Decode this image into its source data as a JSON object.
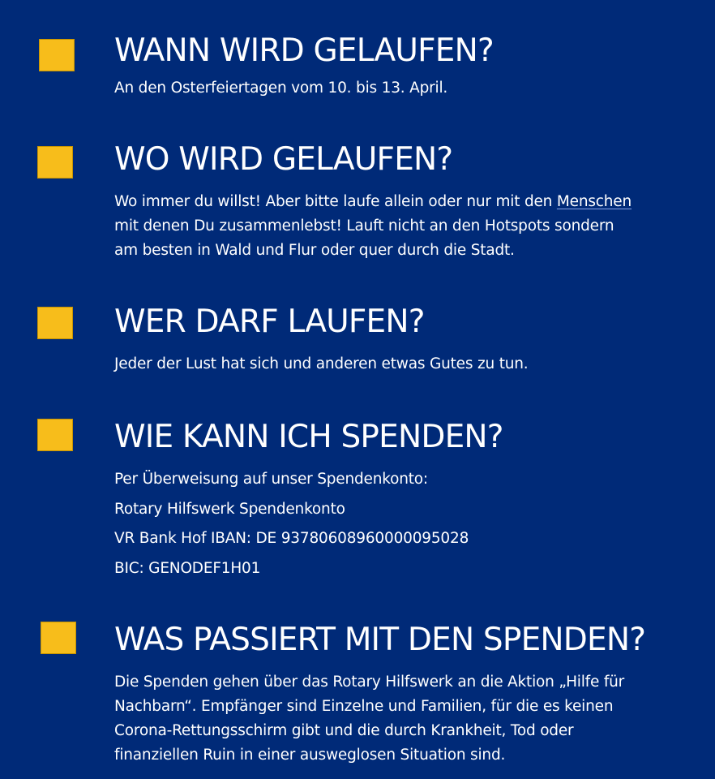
{
  "sections": [
    {
      "heading": "WANN WIRD GELAUFEN?",
      "lines": [
        "An den Osterfeiertagen vom 10. bis 13. April."
      ]
    },
    {
      "heading": "WO WIRD GELAUFEN?",
      "lines": [
        "Wo immer du willst!  Aber bitte laufe allein oder nur mit den ",
        "mit denen Du zusammenlebst!  Lauft nicht an den Hotspots sondern",
        "am besten in Wald und Flur oder quer durch die Stadt."
      ],
      "underlined_word": "Menschen"
    },
    {
      "heading": "WER DARF LAUFEN?",
      "lines": [
        "Jeder der Lust hat sich und anderen etwas Gutes zu tun."
      ]
    },
    {
      "heading": "WIE KANN ICH SPENDEN?",
      "lines": [
        "Per Überweisung auf unser Spendenkonto:",
        "Rotary Hilfswerk Spendenkonto",
        "VR Bank Hof IBAN: DE 93780608960000095028",
        "BIC: GENODEF1H01"
      ]
    },
    {
      "heading": "WAS PASSIERT MIT DEN SPENDEN?",
      "lines": [
        "Die Spenden gehen über das Rotary Hilfswerk an die Aktion „Hilfe für",
        "Nachbarn“.  Empfänger sind Einzelne und Familien, für die es keinen",
        "Corona-Rettungsschirm gibt und die durch Krankheit, Tod oder",
        "finanziellen Ruin in einer ausweglosen Situation sind."
      ]
    }
  ],
  "colors": {
    "background": "#002a78",
    "bullet": "#f7bd1b",
    "text": "#ffffff"
  }
}
